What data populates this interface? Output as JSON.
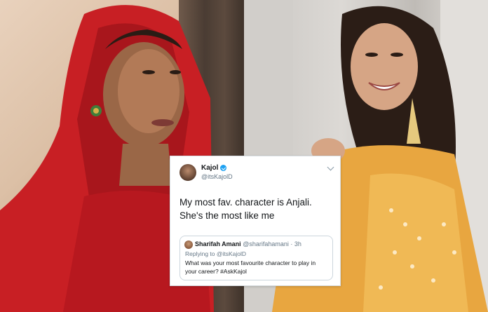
{
  "tweet": {
    "author_name": "Kajol",
    "author_handle": "@itsKajolD",
    "text_line1": "My most fav. character is Anjali.",
    "text_line2": "She's the most like me",
    "quoted": {
      "author_name": "Sharifah Amani",
      "author_handle": "@sharifahamani",
      "time": "3h",
      "replying_to": "Replying to @itsKajolD",
      "text": "What was your most favourite character to play in your career? #AskKajol"
    }
  },
  "colors": {
    "verified": "#1da1f2",
    "scarf_red": "#d42a2a",
    "saree_yellow": "#e8a640"
  },
  "icons": [
    "verified-icon",
    "chevron-down-icon"
  ]
}
